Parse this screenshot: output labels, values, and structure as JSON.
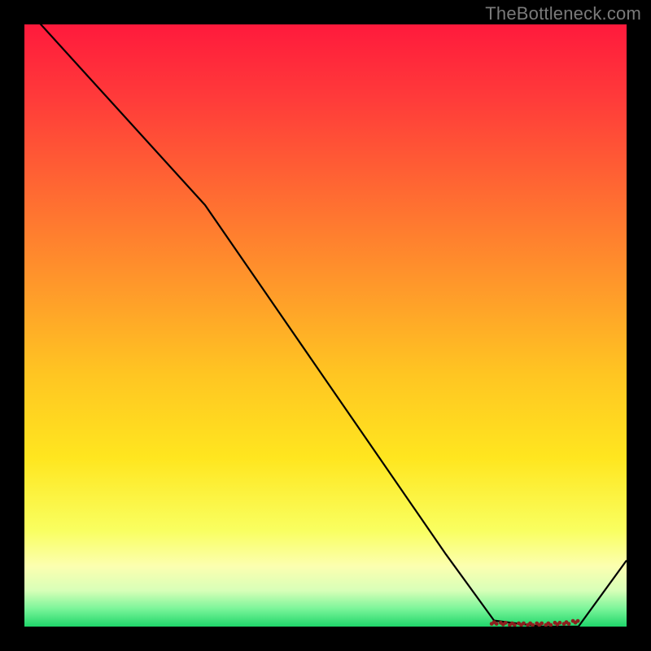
{
  "watermark": "TheBottleneck.com",
  "chart_data": {
    "type": "line",
    "title": "",
    "xlabel": "",
    "ylabel": "",
    "xlim": [
      0,
      100
    ],
    "ylim": [
      0,
      100
    ],
    "series": [
      {
        "name": "curve",
        "x": [
          0,
          10,
          20,
          30,
          40,
          50,
          60,
          70,
          78,
          86,
          92,
          100
        ],
        "y": [
          103,
          92,
          81,
          70,
          55.5,
          41,
          26.5,
          12,
          1,
          0,
          0,
          11
        ]
      }
    ],
    "marker_region": {
      "name": "optimal-zone",
      "x": [
        78,
        79.5,
        81,
        82.5,
        84,
        85.5,
        87,
        88.5,
        90,
        91.5
      ],
      "y": [
        0.6,
        0.5,
        0.4,
        0.4,
        0.4,
        0.4,
        0.4,
        0.5,
        0.6,
        0.8
      ]
    },
    "gradient_stops": [
      {
        "offset": 0.0,
        "color": "#ff1a3c"
      },
      {
        "offset": 0.12,
        "color": "#ff3a3a"
      },
      {
        "offset": 0.28,
        "color": "#ff6a32"
      },
      {
        "offset": 0.44,
        "color": "#ff9a2a"
      },
      {
        "offset": 0.58,
        "color": "#ffc522"
      },
      {
        "offset": 0.72,
        "color": "#ffe61f"
      },
      {
        "offset": 0.84,
        "color": "#f9ff60"
      },
      {
        "offset": 0.9,
        "color": "#fcffb0"
      },
      {
        "offset": 0.94,
        "color": "#d8ffb8"
      },
      {
        "offset": 0.97,
        "color": "#7cf59a"
      },
      {
        "offset": 1.0,
        "color": "#1fd66a"
      }
    ]
  }
}
